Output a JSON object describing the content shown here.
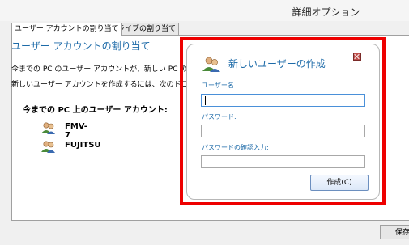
{
  "window": {
    "title": "詳細オプション"
  },
  "tabs": [
    {
      "label": "ユーザー アカウントの割り当て"
    },
    {
      "label": "ドライブの割り当て"
    }
  ],
  "panel": {
    "heading": "ユーザー アカウントの割り当て",
    "paragraph1": "今までの PC のユーザー アカウントが、新しい PC のユーザ",
    "paragraph2": "新しいユーザー アカウントを作成するには、次のドロップダウ",
    "accounts_heading": "今までの PC 上のユーザー アカウント:",
    "accounts": [
      {
        "name": "FMV-7",
        "icon": "users-icon"
      },
      {
        "name": "FUJITSU",
        "icon": "users-icon"
      }
    ]
  },
  "dialog": {
    "title": "新しいユーザーの作成",
    "username_label": "ユーザー名",
    "username_value": "",
    "password_label": "パスワード:",
    "password_value": "",
    "confirm_label": "パスワードの確認入力:",
    "confirm_value": "",
    "create_button": "作成(C)"
  },
  "footer": {
    "save_button": "保存"
  },
  "colors": {
    "accent": "#1c6aa8",
    "highlight": "#ee0000"
  }
}
